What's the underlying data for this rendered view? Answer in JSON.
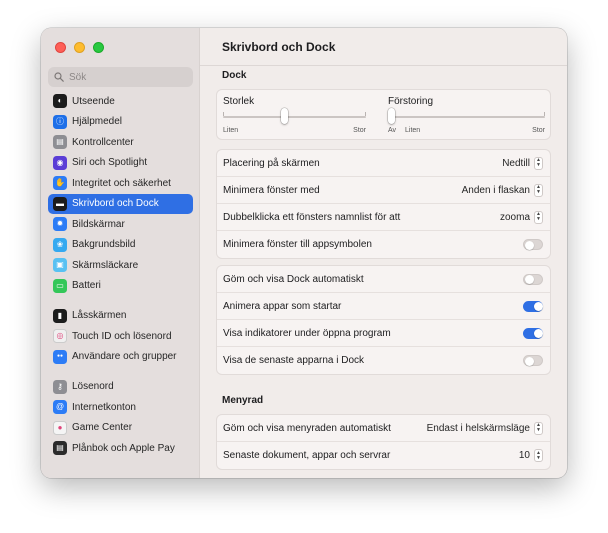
{
  "sidebar": {
    "search_placeholder": "Sök",
    "items": [
      {
        "label": "Utseende",
        "icon": "appearance-icon",
        "color": "#1c1c1c"
      },
      {
        "label": "Hjälpmedel",
        "icon": "accessibility-icon",
        "color": "#1e6fe8"
      },
      {
        "label": "Kontrollcenter",
        "icon": "control-center-icon",
        "color": "#8e8e93"
      },
      {
        "label": "Siri och Spotlight",
        "icon": "siri-icon",
        "color": "#5b3dd6"
      },
      {
        "label": "Integritet och säkerhet",
        "icon": "privacy-hand-icon",
        "color": "#2c7cf6"
      },
      {
        "label": "Skrivbord och Dock",
        "icon": "desktop-dock-icon",
        "color": "#1c1c1c",
        "selected": true
      },
      {
        "label": "Bildskärmar",
        "icon": "displays-icon",
        "color": "#2c7cf6"
      },
      {
        "label": "Bakgrundsbild",
        "icon": "wallpaper-icon",
        "color": "#35a9f0"
      },
      {
        "label": "Skärmsläckare",
        "icon": "screensaver-icon",
        "color": "#58c1f2"
      },
      {
        "label": "Batteri",
        "icon": "battery-icon",
        "color": "#34c759"
      },
      {
        "label": "Låsskärmen",
        "icon": "lock-screen-icon",
        "color": "#1c1c1c"
      },
      {
        "label": "Touch ID och lösenord",
        "icon": "touch-id-icon",
        "color": "#f0f0f0"
      },
      {
        "label": "Användare och grupper",
        "icon": "users-groups-icon",
        "color": "#2c7cf6"
      },
      {
        "label": "Lösenord",
        "icon": "key-icon",
        "color": "#8e8e93"
      },
      {
        "label": "Internetkonton",
        "icon": "at-sign-icon",
        "color": "#2c7cf6"
      },
      {
        "label": "Game Center",
        "icon": "game-center-icon",
        "color": "#f5f5f5"
      },
      {
        "label": "Plånbok och Apple Pay",
        "icon": "wallet-icon",
        "color": "#2b2b2b"
      }
    ]
  },
  "main": {
    "title": "Skrivbord och Dock",
    "dock": {
      "heading": "Dock",
      "size": {
        "label": "Storlek",
        "min": "Liten",
        "max": "Stor",
        "value": 0.43
      },
      "magnification": {
        "label": "Förstoring",
        "off": "Av",
        "min": "Liten",
        "max": "Stor",
        "value": 0.0
      },
      "rows": [
        {
          "label": "Placering på skärmen",
          "value": "Nedtill"
        },
        {
          "label": "Minimera fönster med",
          "value": "Anden i flaskan"
        },
        {
          "label": "Dubbelklicka ett fönsters namnlist för att",
          "value": "zooma"
        }
      ],
      "toggle_row": {
        "label": "Minimera fönster till appsymbolen",
        "on": false
      },
      "toggles": [
        {
          "label": "Göm och visa Dock automatiskt",
          "on": false
        },
        {
          "label": "Animera appar som startar",
          "on": true
        },
        {
          "label": "Visa indikatorer under öppna program",
          "on": true
        },
        {
          "label": "Visa de senaste apparna i Dock",
          "on": false
        }
      ]
    },
    "menubar": {
      "heading": "Menyrad",
      "rows": [
        {
          "label": "Göm och visa menyraden automatiskt",
          "value": "Endast i helskärmsläge"
        },
        {
          "label": "Senaste dokument, appar och servrar",
          "value": "10"
        }
      ]
    }
  }
}
